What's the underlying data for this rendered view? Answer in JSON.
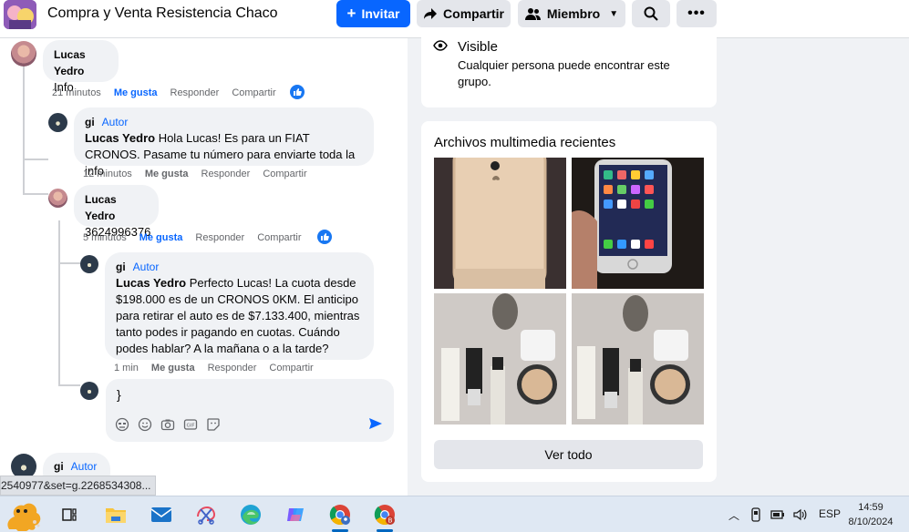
{
  "header": {
    "group_title": "Compra y Venta Resistencia Chaco",
    "invite_label": "Invitar",
    "share_label": "Compartir",
    "member_label": "Miembro"
  },
  "comments": [
    {
      "author": "Lucas Yedro",
      "text": "Info",
      "time": "21 minutos",
      "like_label": "Me gusta",
      "reply_label": "Responder",
      "share_label": "Compartir"
    },
    {
      "author": "gi",
      "badge": "Autor",
      "mention": "Lucas Yedro",
      "text": " Hola Lucas! Es para un FIAT CRONOS. Pasame tu número para enviarte toda la info",
      "time": "12 minutos",
      "like_label": "Me gusta",
      "reply_label": "Responder",
      "share_label": "Compartir"
    },
    {
      "author": "Lucas Yedro",
      "text": "3624996376",
      "time": "5 minutos",
      "like_label": "Me gusta",
      "reply_label": "Responder",
      "share_label": "Compartir"
    },
    {
      "author": "gi",
      "badge": "Autor",
      "mention": "Lucas Yedro",
      "text": " Perfecto Lucas! La cuota desde $198.000 es de un CRONOS 0KM. El anticipo para retirar el auto es de $7.133.400, mientras tanto podes ir pagando en cuotas. Cuándo podes hablar? A la mañana o a la tarde?",
      "time": "1 min",
      "like_label": "Me gusta",
      "reply_label": "Responder",
      "share_label": "Compartir"
    },
    {
      "author": "gi",
      "badge": "Autor"
    }
  ],
  "reply_box": {
    "value": "}"
  },
  "url_tooltip": "2540977&set=g.2268534308...",
  "visibility": {
    "title": "Visible",
    "description": "Cualquier persona puede encontrar este grupo."
  },
  "media": {
    "title": "Archivos multimedia recientes",
    "see_all_label": "Ver todo"
  },
  "taskbar": {
    "language": "ESP",
    "time": "14:59",
    "date": "8/10/2024"
  },
  "colors": {
    "accent": "#0866ff",
    "background": "#f0f2f5"
  }
}
